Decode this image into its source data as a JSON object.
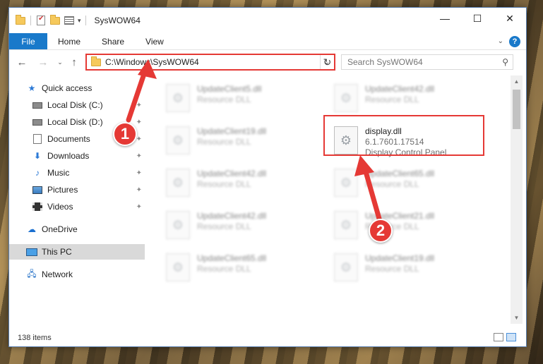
{
  "window": {
    "title": "SysWOW64",
    "controls": {
      "minimize": "—",
      "maximize": "☐",
      "close": "✕"
    }
  },
  "ribbon": {
    "tabs": [
      "File",
      "Home",
      "Share",
      "View"
    ]
  },
  "address": {
    "path": "C:\\Windows\\SysWOW64",
    "search_placeholder": "Search SysWOW64"
  },
  "sidebar": {
    "items": [
      {
        "label": "Quick access",
        "icon": "star-icon"
      },
      {
        "label": "Local Disk (C:)",
        "icon": "disk-icon",
        "pinned": true
      },
      {
        "label": "Local Disk (D:)",
        "icon": "disk-icon",
        "pinned": true
      },
      {
        "label": "Documents",
        "icon": "documents-icon",
        "pinned": true
      },
      {
        "label": "Downloads",
        "icon": "downloads-icon",
        "pinned": true
      },
      {
        "label": "Music",
        "icon": "music-icon",
        "pinned": true
      },
      {
        "label": "Pictures",
        "icon": "pictures-icon",
        "pinned": true
      },
      {
        "label": "Videos",
        "icon": "videos-icon",
        "pinned": true
      },
      {
        "label": "OneDrive",
        "icon": "onedrive-icon"
      },
      {
        "label": "This PC",
        "icon": "this-pc-icon",
        "selected": true
      },
      {
        "label": "Network",
        "icon": "network-icon"
      }
    ]
  },
  "files": {
    "left": [
      {
        "name": "UpdateClient5.dll",
        "desc": "Resource DLL"
      },
      {
        "name": "UpdateClient19.dll",
        "desc": "Resource DLL"
      },
      {
        "name": "UpdateClient42.dll",
        "desc": "Resource DLL"
      },
      {
        "name": "UpdateClient42.dll",
        "desc": "Resource DLL"
      },
      {
        "name": "UpdateClient65.dll",
        "desc": "Resource DLL"
      }
    ],
    "right": [
      {
        "name": "UpdateClient42.dll",
        "desc": "Resource DLL"
      },
      {
        "name": "display.dll",
        "version": "6.1.7601.17514",
        "desc": "Display Control Panel"
      },
      {
        "name": "UpdateClient65.dll",
        "desc": "Resource DLL"
      },
      {
        "name": "UpdateClient21.dll",
        "desc": "Resource DLL"
      },
      {
        "name": "UpdateClient19.dll",
        "desc": "Resource DLL"
      }
    ]
  },
  "status": {
    "item_count": "138 items"
  },
  "annotations": {
    "badge1": "1",
    "badge2": "2",
    "color": "#e53935"
  }
}
